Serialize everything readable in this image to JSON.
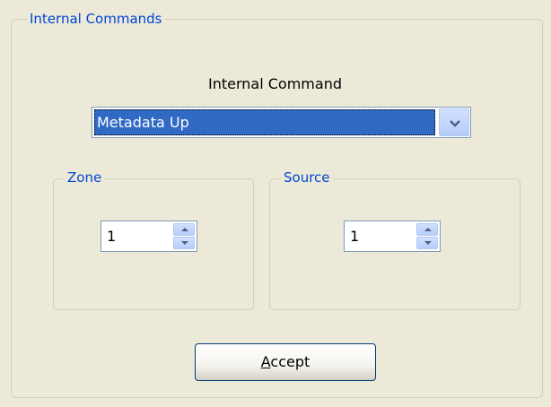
{
  "group": {
    "title": "Internal Commands"
  },
  "command": {
    "label": "Internal Command",
    "selected": "Metadata Up",
    "dropdown_icon": "chevron-down-icon"
  },
  "zone": {
    "title": "Zone",
    "value": "1"
  },
  "source": {
    "title": "Source",
    "value": "1"
  },
  "accept": {
    "mnemonic": "A",
    "rest": "ccept"
  },
  "colors": {
    "group_title": "#0046d5",
    "selection": "#316ac5",
    "panel": "#ece9d8"
  }
}
